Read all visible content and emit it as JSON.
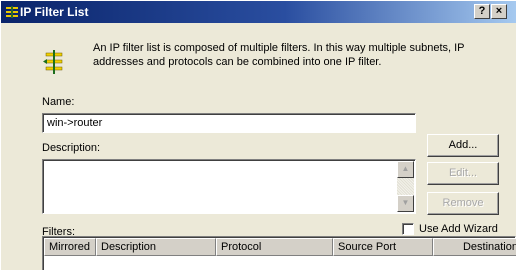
{
  "window": {
    "title": "IP Filter List",
    "help_label": "?",
    "close_label": "×"
  },
  "info": {
    "text": "An IP filter list is composed of multiple filters. In this way multiple subnets, IP addresses and protocols can be combined into one IP filter."
  },
  "name": {
    "label": "Name:",
    "value": "win->router"
  },
  "description": {
    "label": "Description:",
    "value": ""
  },
  "buttons": {
    "add": "Add...",
    "edit": "Edit...",
    "remove": "Remove"
  },
  "filters": {
    "label": "Filters:",
    "use_add_wizard": "Use Add Wizard",
    "use_add_wizard_checked": false,
    "columns": [
      "Mirrored",
      "Description",
      "Protocol",
      "Source Port",
      "Destination"
    ]
  },
  "icons": {
    "window_icon": "filter-list-icon",
    "info_icon": "ip-filter-icon"
  },
  "colors": {
    "title_gradient_start": "#0a246a",
    "title_gradient_end": "#a6caf0",
    "dialog_bg": "#ece9d8"
  }
}
